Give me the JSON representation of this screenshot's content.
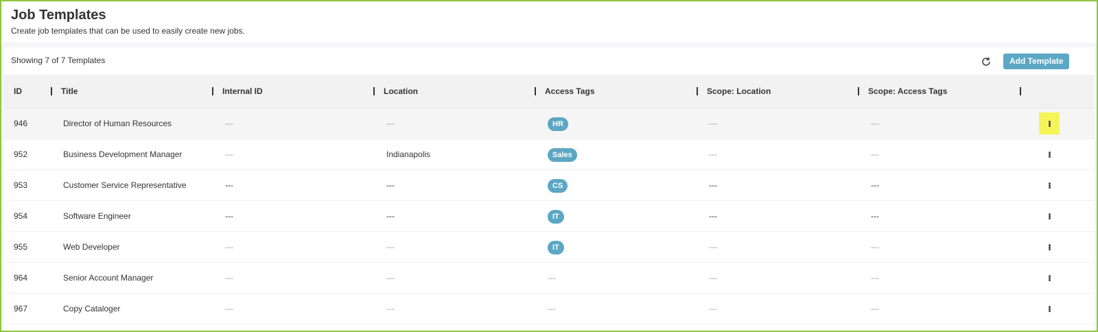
{
  "header": {
    "title": "Job Templates",
    "subtitle": "Create job templates that can be used to easily create new jobs."
  },
  "toolbar": {
    "showing": "Showing 7 of 7 Templates",
    "add_label": "Add Template",
    "refresh_icon": "refresh-icon"
  },
  "columns": [
    "ID",
    "Title",
    "Internal ID",
    "Location",
    "Access Tags",
    "Scope: Location",
    "Scope: Access Tags"
  ],
  "colors": {
    "accent": "#5ba7c4",
    "frame_border": "#8cc63f",
    "highlight": "#f5f55a"
  },
  "rows": [
    {
      "id": "946",
      "title": "Director of Human Resources",
      "internal_id": "---",
      "location": "---",
      "tag": "HR",
      "scope_location": "---",
      "scope_tags": "---"
    },
    {
      "id": "952",
      "title": "Business Development Manager",
      "internal_id": "---",
      "location": "Indianapolis",
      "tag": "Sales",
      "scope_location": "---",
      "scope_tags": "---"
    },
    {
      "id": "953",
      "title": "Customer Service Representative",
      "internal_id": "---",
      "location": "---",
      "tag": "CS",
      "scope_location": "---",
      "scope_tags": "---"
    },
    {
      "id": "954",
      "title": "Software Engineer",
      "internal_id": "---",
      "location": "---",
      "tag": "IT",
      "scope_location": "---",
      "scope_tags": "---"
    },
    {
      "id": "955",
      "title": "Web Developer",
      "internal_id": "---",
      "location": "---",
      "tag": "IT",
      "scope_location": "---",
      "scope_tags": "---"
    },
    {
      "id": "964",
      "title": "Senior Account Manager",
      "internal_id": "---",
      "location": "---",
      "tag_empty": "---",
      "scope_location": "---",
      "scope_tags": "---"
    },
    {
      "id": "967",
      "title": "Copy Cataloger",
      "internal_id": "---",
      "location": "---",
      "tag_empty": "---",
      "scope_location": "---",
      "scope_tags": "---"
    }
  ]
}
